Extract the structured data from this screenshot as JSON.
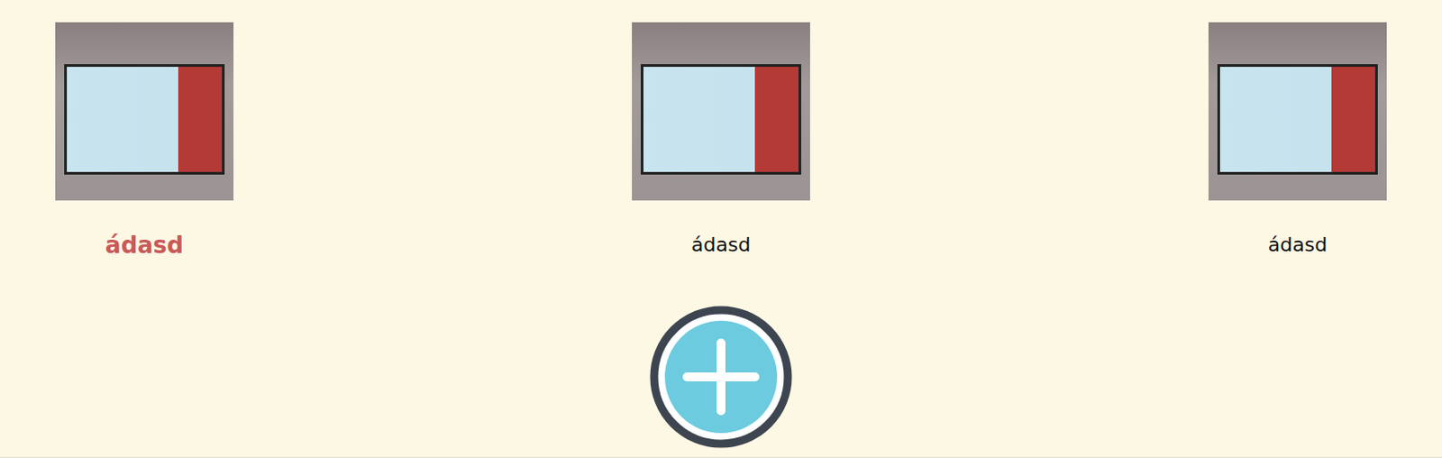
{
  "gallery": {
    "items": [
      {
        "label": "ádasd",
        "selected": true
      },
      {
        "label": "ádasd",
        "selected": false
      },
      {
        "label": "ádasd",
        "selected": false
      }
    ]
  }
}
